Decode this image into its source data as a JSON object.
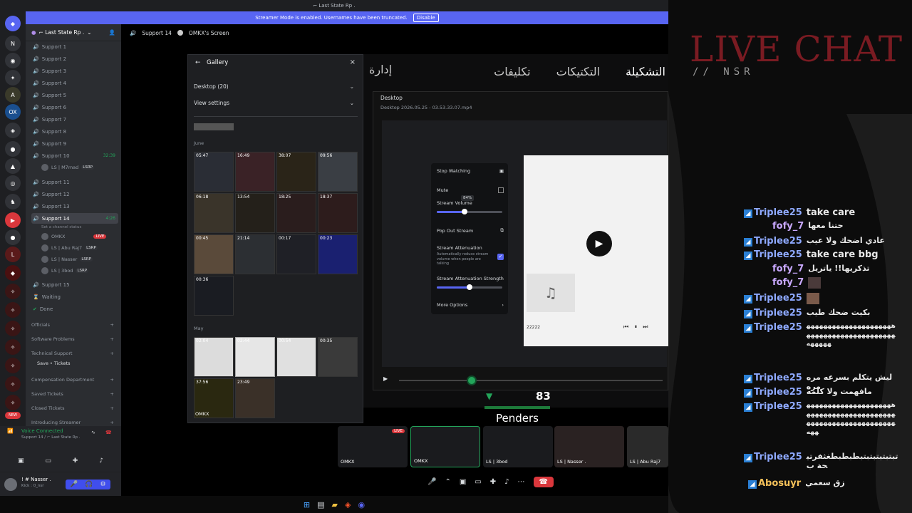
{
  "window": {
    "title": "⌐ Last State Rp ."
  },
  "banner": {
    "text": "Streamer Mode is enabled. Usernames have been truncated.",
    "button": "Disable"
  },
  "server": {
    "name": "⌐ Last State Rp ."
  },
  "main_header": {
    "channel": "Support 14",
    "screen": "OMKX's Screen"
  },
  "channels": [
    {
      "label": "Support 1"
    },
    {
      "label": "Support 2"
    },
    {
      "label": "Support 3"
    },
    {
      "label": "Support 4"
    },
    {
      "label": "Support 5"
    },
    {
      "label": "Support 6"
    },
    {
      "label": "Support 7"
    },
    {
      "label": "Support 8"
    },
    {
      "label": "Support 9"
    },
    {
      "label": "Support 10",
      "time": "32:39"
    },
    {
      "label": "Support 11"
    },
    {
      "label": "Support 12"
    },
    {
      "label": "Support 13"
    },
    {
      "label": "Support 14",
      "time": "4:26"
    },
    {
      "label": "Support 15"
    },
    {
      "label": "Waiting"
    },
    {
      "label": "Done"
    }
  ],
  "support10_member": {
    "name": "LS | M7mad",
    "badge": "LSRP"
  },
  "support14_status": "Set a channel status",
  "support14_members": [
    {
      "name": "OMKX",
      "tag": "LIVE"
    },
    {
      "name": "LS | Abu Raj7",
      "badge": "LSRP"
    },
    {
      "name": "LS | Nasser",
      "badge": "LSRP"
    },
    {
      "name": "LS | 3bod",
      "badge": "LSRP"
    }
  ],
  "categories": [
    {
      "label": "Officials"
    },
    {
      "label": "Software Problems"
    },
    {
      "label": "Technical Support"
    },
    {
      "label": "Save • Tickets"
    },
    {
      "label": "Compensation Department"
    },
    {
      "label": "Saved Tickets"
    },
    {
      "label": "Closed Tickets"
    },
    {
      "label": "Introducing Streamer"
    }
  ],
  "voice": {
    "title": "Voice Connected",
    "sub": "Support 14 / ⌐ Last State Rp ."
  },
  "user": {
    "name": "! # Nasser .",
    "status": "Kick : 0_nsr"
  },
  "gallery": {
    "title": "Gallery",
    "source": "Desktop (20)",
    "settings": "View settings",
    "june_label": "June",
    "may_label": "May",
    "june_times": [
      "05:47",
      "16:49",
      "38:07",
      "09:56",
      "06:18",
      "13:54",
      "18:25",
      "18:37",
      "00:45",
      "21:14",
      "00:17",
      "00:23",
      "00:36"
    ],
    "may_times": [
      "02:04",
      "02:44",
      "00:54",
      "00:35",
      "37:56",
      "23:49"
    ],
    "last_tag": "OMKX"
  },
  "tabs": [
    "إدارة",
    "التشكيلة",
    "التكتيكات",
    "تكليفات"
  ],
  "player": {
    "title": "Desktop",
    "file": "Desktop 2026.05.25 - 03.53.33.07.mp4"
  },
  "popup": {
    "stop": "Stop Watching",
    "mute": "Mute",
    "volume_label": "Stream Volume",
    "volume_value": "84%",
    "volume_level": 0.42,
    "popout": "Pop Out Stream",
    "attenuation": "Stream Attenuation",
    "attenuation_desc": "Automatically reduce stream volume when people are talking",
    "strength": "Stream Attenuation Strength",
    "strength_level": 0.5,
    "more": "More Options"
  },
  "inner_player": {
    "time": "22222"
  },
  "game_overlay": {
    "score": "83",
    "name": "Penders"
  },
  "stream_tiles": [
    {
      "label": "OMKX",
      "tag": "LIVE"
    },
    {
      "label": "OMKX"
    },
    {
      "label": "LS | 3bod"
    },
    {
      "label": "LS | Nasser ."
    },
    {
      "label": "LS | Abu Raj7"
    }
  ],
  "chat_overlay": {
    "title": "LIVE CHAT",
    "subtitle": "// NSR",
    "messages": [
      {
        "user": "Triplee25",
        "text": "take care"
      },
      {
        "user": "fofy_7",
        "text": "حتنا معها"
      },
      {
        "user": "Triplee25",
        "text": "عادي اضحك ولا عيب"
      },
      {
        "user": "Triplee25",
        "text": "take care bbg"
      },
      {
        "user": "fofy_7",
        "text": "تذكريها!! ياتريل"
      },
      {
        "user": "fofy_7",
        "text": ""
      },
      {
        "user": "Triplee25",
        "text": ""
      },
      {
        "user": "Triplee25",
        "text": "بكيت ضحك طيب"
      },
      {
        "user": "Triplee25",
        "text": "هههههههههههههههههههههههههههههههههههههههههههههههه"
      },
      {
        "user": "Triplee25",
        "text": "ليش يتكلم بسرعه مره مره"
      },
      {
        "user": "Triplee25",
        "text": "مافهمت ولا كلمه"
      },
      {
        "user": "Triplee25",
        "text": "هههههههههههههههههههههههههههههههههههههههههههههههههههههههههههههههههه"
      },
      {
        "user": "Triplee25",
        "text": "تبتبتبتبتبتبطبطبطغثفرتيحة ب"
      },
      {
        "user": "Abosuyr",
        "text": "زق سعمي"
      }
    ]
  },
  "colors": {
    "accent": "#5865f2",
    "live": "#da373c",
    "chat_title": "#7a1b22",
    "online": "#23a55a"
  }
}
